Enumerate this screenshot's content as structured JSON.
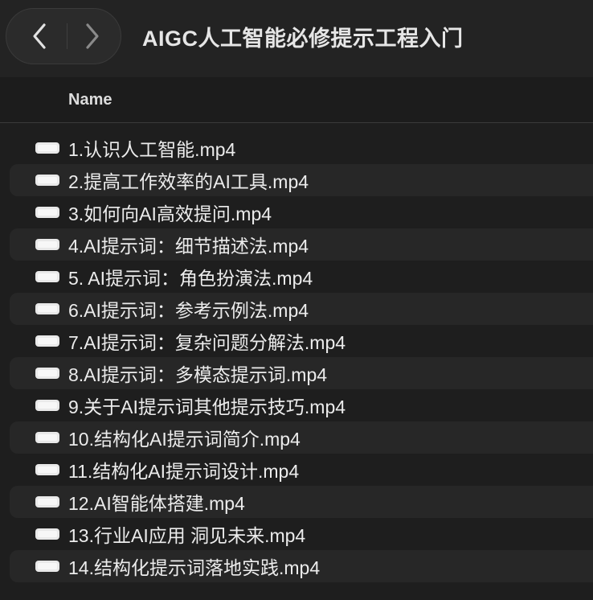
{
  "toolbar": {
    "title": "AIGC人工智能必修提示工程入门",
    "back_icon": "chevron-left-icon",
    "forward_icon": "chevron-right-icon"
  },
  "columns": {
    "name": "Name"
  },
  "files": [
    {
      "name": "1.认识人工智能.mp4",
      "icon": "video-file-icon"
    },
    {
      "name": "2.提高工作效率的AI工具.mp4",
      "icon": "video-file-icon"
    },
    {
      "name": "3.如何向AI高效提问.mp4",
      "icon": "video-file-icon"
    },
    {
      "name": "4.AI提示词：细节描述法.mp4",
      "icon": "video-file-icon"
    },
    {
      "name": "5. AI提示词：角色扮演法.mp4",
      "icon": "video-file-icon"
    },
    {
      "name": "6.AI提示词：参考示例法.mp4",
      "icon": "video-file-icon"
    },
    {
      "name": "7.AI提示词：复杂问题分解法.mp4",
      "icon": "video-file-icon"
    },
    {
      "name": "8.AI提示词：多模态提示词.mp4",
      "icon": "video-file-icon"
    },
    {
      "name": "9.关于AI提示词其他提示技巧.mp4",
      "icon": "video-file-icon"
    },
    {
      "name": "10.结构化AI提示词简介.mp4",
      "icon": "video-file-icon"
    },
    {
      "name": "11.结构化AI提示词设计.mp4",
      "icon": "video-file-icon"
    },
    {
      "name": "12.AI智能体搭建.mp4",
      "icon": "video-file-icon"
    },
    {
      "name": "13.行业AI应用 洞见未来.mp4",
      "icon": "video-file-icon"
    },
    {
      "name": "14.结构化提示词落地实践.mp4",
      "icon": "video-file-icon"
    }
  ]
}
